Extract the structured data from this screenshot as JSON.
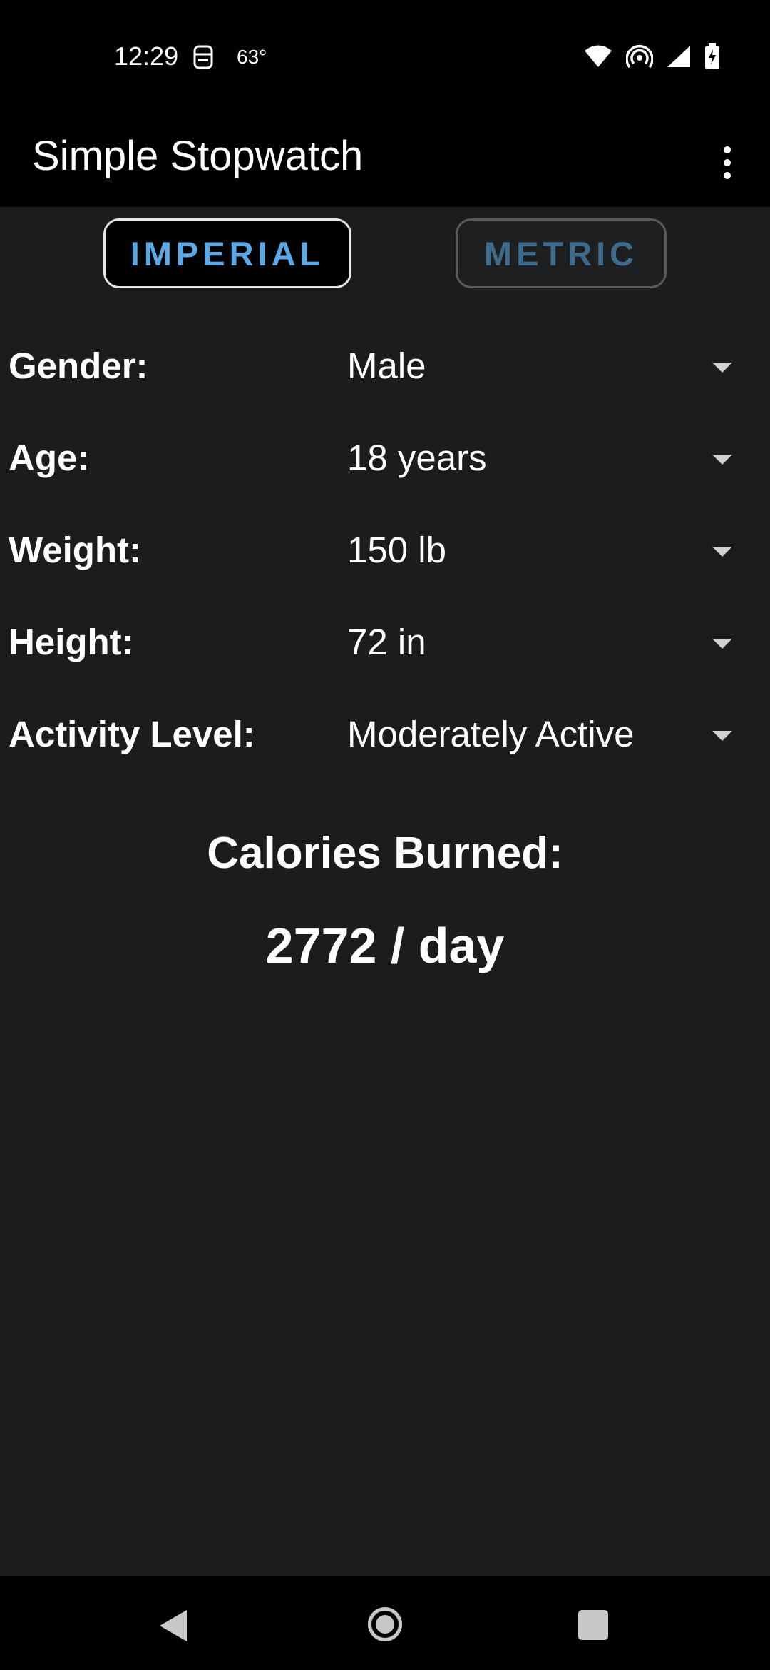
{
  "status_bar": {
    "time": "12:29",
    "temperature": "63°",
    "icons": [
      "notification-icon",
      "weather-icon",
      "wifi-icon",
      "hotspot-icon",
      "signal-icon",
      "battery-charging-icon"
    ]
  },
  "app_bar": {
    "title": "Simple Stopwatch",
    "menu_icon": "more-vert-icon"
  },
  "unit_toggle": {
    "imperial_label": "IMPERIAL",
    "metric_label": "METRIC",
    "selected": "IMPERIAL",
    "accent_color": "#5aa9e6"
  },
  "form": {
    "gender": {
      "label": "Gender:",
      "value": "Male"
    },
    "age": {
      "label": "Age:",
      "value": "18 years"
    },
    "weight": {
      "label": "Weight:",
      "value": "150 lb"
    },
    "height": {
      "label": "Height:",
      "value": "72 in"
    },
    "activity": {
      "label": "Activity Level:",
      "value": "Moderately Active"
    }
  },
  "result": {
    "title": "Calories Burned:",
    "value": "2772 / day"
  },
  "nav_bar": {
    "icons": [
      "back-icon",
      "home-icon",
      "recents-icon"
    ]
  }
}
